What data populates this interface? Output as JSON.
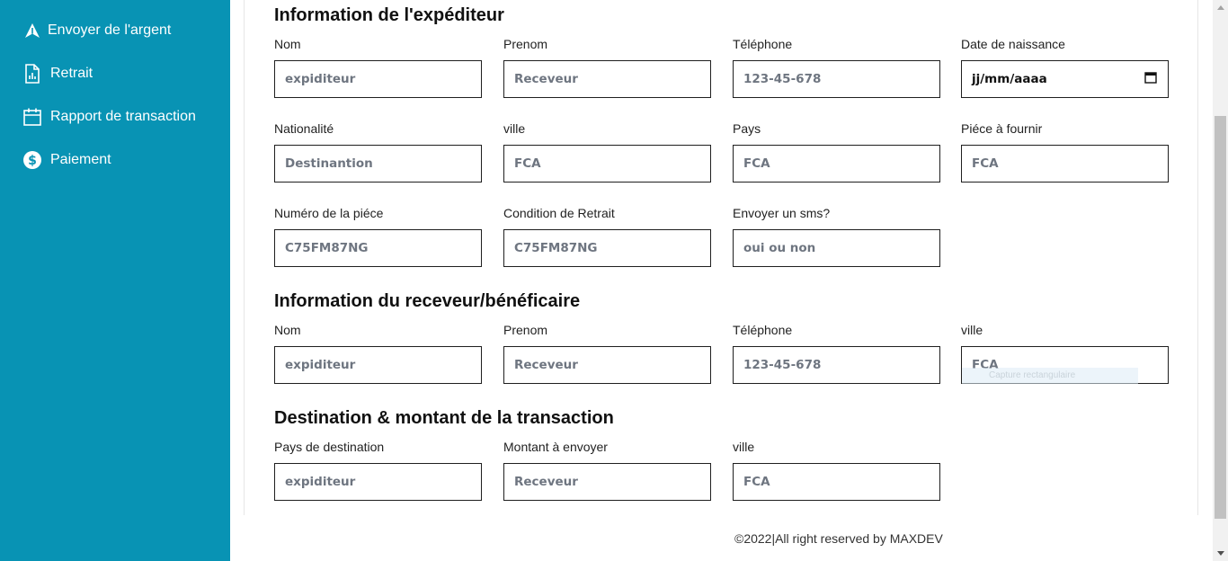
{
  "sidebar": {
    "items": [
      {
        "label": "Envoyer de l'argent",
        "icon": "send-icon"
      },
      {
        "label": "Retrait",
        "icon": "receipt-icon"
      },
      {
        "label": "Rapport de transaction",
        "icon": "calendar-icon"
      },
      {
        "label": "Paiement",
        "icon": "dollar-icon"
      }
    ],
    "background": "#0893b4"
  },
  "sender": {
    "title": "Information de l'expéditeur",
    "nom": {
      "label": "Nom",
      "placeholder": "expiditeur"
    },
    "prenom": {
      "label": "Prenom",
      "placeholder": "Receveur"
    },
    "telephone": {
      "label": "Téléphone",
      "placeholder": "123-45-678"
    },
    "naissance": {
      "label": "Date de naissance",
      "value": "jj/mm/aaaa"
    },
    "nationalite": {
      "label": "Nationalité",
      "placeholder": "Destinantion"
    },
    "ville": {
      "label": "ville",
      "placeholder": "FCA"
    },
    "pays": {
      "label": "Pays",
      "placeholder": "FCA"
    },
    "piece": {
      "label": "Piéce à fournir",
      "placeholder": "FCA"
    },
    "numero_piece": {
      "label": "Numéro de la piéce",
      "placeholder": "C75FM87NG"
    },
    "condition": {
      "label": "Condition de Retrait",
      "placeholder": "C75FM87NG"
    },
    "sms": {
      "label": "Envoyer un sms?",
      "placeholder": "oui ou non"
    }
  },
  "receiver": {
    "title": "Information du receveur/bénéficaire",
    "nom": {
      "label": "Nom",
      "placeholder": "expiditeur"
    },
    "prenom": {
      "label": "Prenom",
      "placeholder": "Receveur"
    },
    "telephone": {
      "label": "Téléphone",
      "placeholder": "123-45-678"
    },
    "ville": {
      "label": "ville",
      "placeholder": "FCA"
    },
    "ghost_tooltip": "Capture rectangulaire"
  },
  "destination": {
    "title": "Destination & montant de la transaction",
    "pays": {
      "label": "Pays de destination",
      "placeholder": "expiditeur"
    },
    "montant": {
      "label": "Montant à envoyer",
      "placeholder": "Receveur"
    },
    "ville": {
      "label": "ville",
      "placeholder": "FCA"
    }
  },
  "footer": {
    "text": "©2022|All right reserved by MAXDEV"
  }
}
